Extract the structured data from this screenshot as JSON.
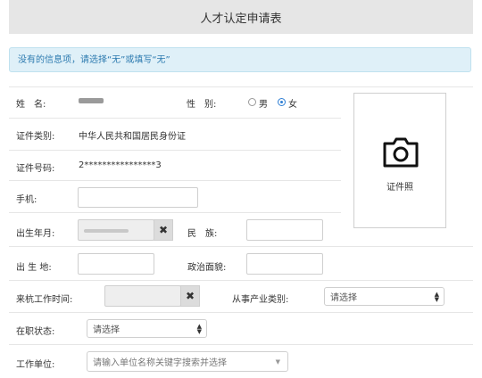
{
  "header": {
    "title": "人才认定申请表"
  },
  "notice": {
    "text": "没有的信息项，请选择“无”或填写“无”"
  },
  "form": {
    "name_label": "姓　名:",
    "gender_label": "性　别:",
    "gender_options": [
      "男",
      "女"
    ],
    "gender_selected": "女",
    "id_type_label": "证件类别:",
    "id_type_value": "中华人民共和国居民身份证",
    "id_number_label": "证件号码:",
    "id_number_value": "2****************3",
    "phone_label": "手机:",
    "birth_label": "出生年月:",
    "ethnicity_label": "民　族:",
    "birthplace_label": "出 生 地:",
    "political_label": "政治面貌:",
    "hangzhou_time_label": "来杭工作时间:",
    "industry_label": "从事产业类别:",
    "industry_placeholder": "请选择",
    "job_status_label": "在职状态:",
    "job_status_placeholder": "请选择",
    "employer_label": "工作单位:",
    "employer_placeholder": "请输入单位名称关键字搜索并选择"
  },
  "photo": {
    "label": "证件照",
    "icon": "camera-icon"
  },
  "colors": {
    "accent": "#2f7fd4",
    "notice_bg": "#dff0f8",
    "notice_text": "#2e7bb0"
  }
}
